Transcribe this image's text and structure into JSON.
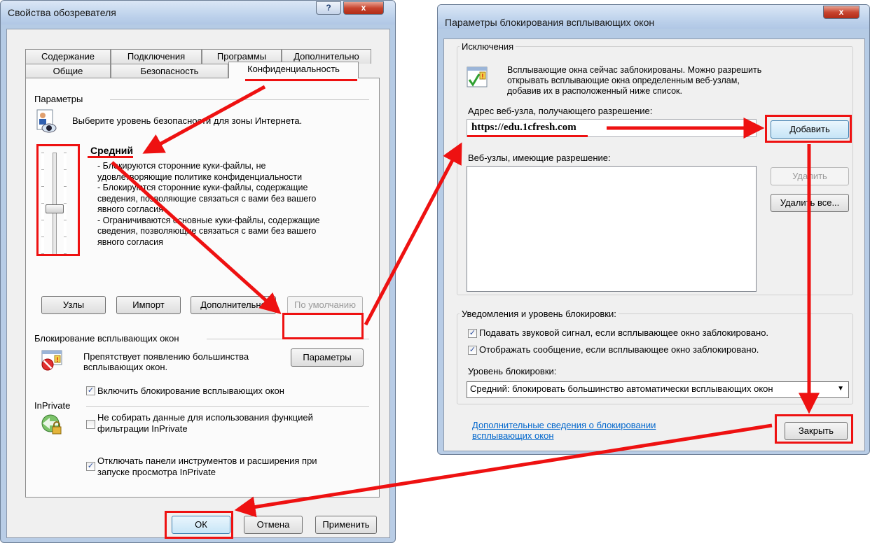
{
  "left_dialog": {
    "title": "Свойства обозревателя",
    "help_glyph": "?",
    "close_glyph": "x",
    "tabs_top": [
      "Содержание",
      "Подключения",
      "Программы",
      "Дополнительно"
    ],
    "tabs_bottom": [
      "Общие",
      "Безопасность",
      "Конфиденциальность"
    ],
    "params_group": "Параметры",
    "zone_text": "Выберите уровень безопасности для зоны Интернета.",
    "level_title": "Средний",
    "level_lines": [
      "- Блокируются сторонние куки-файлы, не",
      "удовлетворяющие политике конфиденциальности",
      "- Блокируются сторонние куки-файлы, содержащие",
      "сведения, позволяющие связаться с вами без вашего",
      "явного согласия",
      "- Ограничиваются основные куки-файлы, содержащие",
      "сведения, позволяющие связаться с вами без вашего",
      "явного согласия"
    ],
    "btn_sites": "Узлы",
    "btn_import": "Импорт",
    "btn_advanced": "Дополнительно",
    "btn_default": "По умолчанию",
    "popup_group": "Блокирование всплывающих окон",
    "popup_text_1": "Препятствует появлению большинства",
    "popup_text_2": "всплывающих окон.",
    "btn_params": "Параметры",
    "cb_popup": "Включить блокирование всплывающих окон",
    "cb_popup_checked": true,
    "inprivate_group": "InPrivate",
    "cb_filter_1": "Не собирать данные для использования функцией",
    "cb_filter_2": "фильтрации InPrivate",
    "cb_filter_checked": false,
    "cb_toolbars_1": "Отключать панели инструментов и расширения при",
    "cb_toolbars_2": "запуске просмотра InPrivate",
    "cb_toolbars_checked": true,
    "btn_ok": "ОК",
    "btn_cancel": "Отмена",
    "btn_apply": "Применить"
  },
  "right_dialog": {
    "title": "Параметры блокирования всплывающих окон",
    "close_glyph": "x",
    "exceptions_group": "Исключения",
    "info_1": "Всплывающие окна сейчас заблокированы.  Можно разрешить",
    "info_2": "открывать всплывающие окна определенным веб-узлам,",
    "info_3": "добавив их в расположенный ниже список.",
    "address_label": "Адрес веб-узла, получающего разрешение:",
    "address_value": "https://edu.1cfresh.com",
    "btn_add": "Добавить",
    "allowed_label": "Веб-узлы, имеющие разрешение:",
    "btn_remove": "Удалить",
    "btn_remove_all": "Удалить все...",
    "notify_group": "Уведомления и уровень блокировки:",
    "cb_sound": "Подавать звуковой сигнал, если всплывающее окно заблокировано.",
    "cb_sound_checked": true,
    "cb_message": "Отображать сообщение, если всплывающее окно заблокировано.",
    "cb_message_checked": true,
    "level_label": "Уровень блокировки:",
    "level_value": "Средний: блокировать большинство автоматически всплывающих окон",
    "link_1": "Дополнительные сведения о блокировании",
    "link_2": "всплывающих окон",
    "btn_close": "Закрыть"
  },
  "check_glyph": "✓",
  "dropdown_glyph": "▼",
  "colors": {
    "highlight": "#ee1111",
    "link": "#0066cc"
  }
}
